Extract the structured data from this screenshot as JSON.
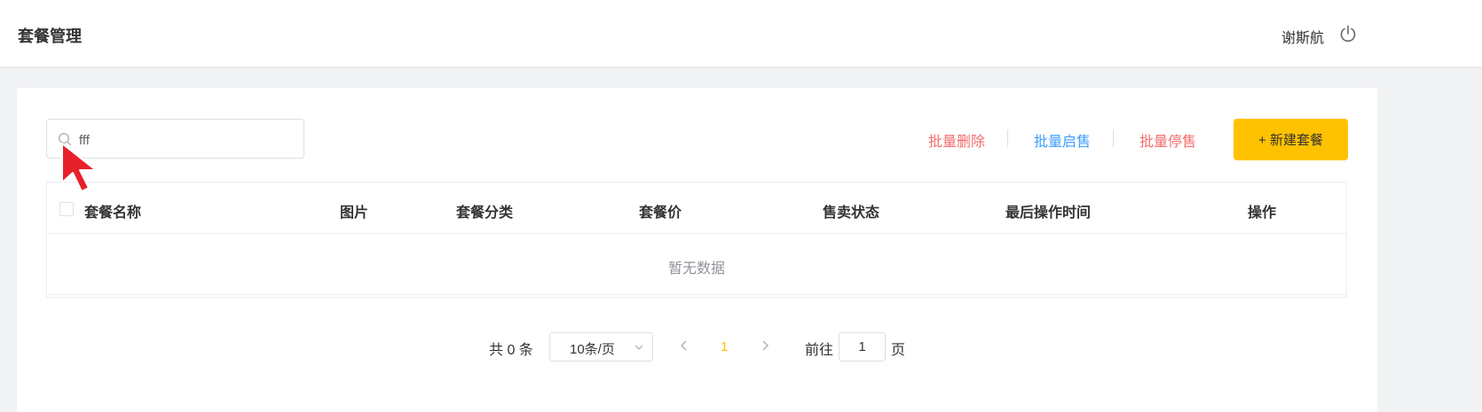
{
  "header": {
    "title": "套餐管理",
    "user_name": "谢斯航",
    "logout_icon": "power-icon"
  },
  "toolbar": {
    "search_value": "fff",
    "search_icon": "search-icon",
    "batch_delete": "批量删除",
    "batch_enable": "批量启售",
    "batch_disable": "批量停售",
    "new_button": "+ 新建套餐"
  },
  "table": {
    "columns": [
      "套餐名称",
      "图片",
      "套餐分类",
      "套餐价",
      "售卖状态",
      "最后操作时间",
      "操作"
    ],
    "empty_text": "暂无数据"
  },
  "pagination": {
    "total": "共 0 条",
    "page_size": "10条/页",
    "current_page": "1",
    "goto_label": "前往",
    "goto_value": "1",
    "goto_suffix": "页"
  },
  "colors": {
    "accent": "#ffc200",
    "danger": "#f56c6c",
    "primary": "#409eff"
  }
}
